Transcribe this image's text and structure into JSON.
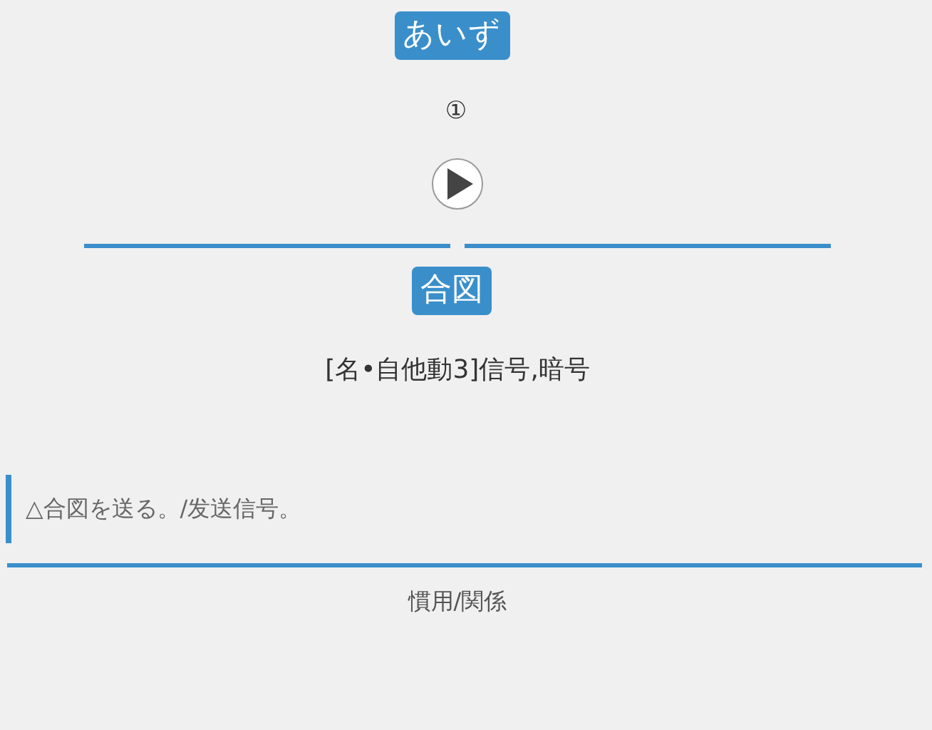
{
  "reading": "あいず",
  "accent": "①",
  "word": "合図",
  "definition": "[名•自他動3]信号,暗号",
  "example": "△合図を送る。/发送信号。",
  "footer_link": "慣用/関係"
}
